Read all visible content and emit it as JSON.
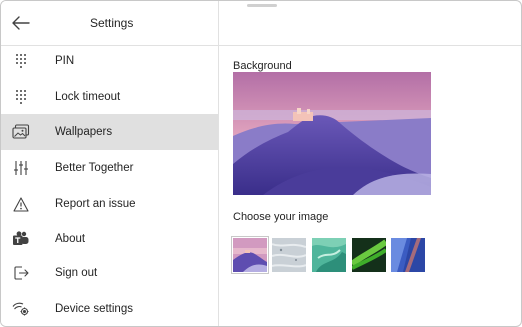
{
  "sidebar": {
    "title": "Settings",
    "items": [
      {
        "label": "PIN",
        "icon": "keypad-icon",
        "selected": false
      },
      {
        "label": "Lock timeout",
        "icon": "keypad-icon",
        "selected": false
      },
      {
        "label": "Wallpapers",
        "icon": "wallpaper-icon",
        "selected": true
      },
      {
        "label": "Better Together",
        "icon": "sliders-icon",
        "selected": false
      },
      {
        "label": "Report an issue",
        "icon": "warning-icon",
        "selected": false
      },
      {
        "label": "About",
        "icon": "teams-icon",
        "selected": false
      },
      {
        "label": "Sign out",
        "icon": "sign-out-icon",
        "selected": false
      },
      {
        "label": "Device settings",
        "icon": "device-settings-icon",
        "selected": false
      }
    ]
  },
  "main": {
    "background_label": "Background",
    "choose_label": "Choose your image",
    "thumbnails": [
      {
        "name": "purple-castle",
        "selected": true
      },
      {
        "name": "snow-texture",
        "selected": false
      },
      {
        "name": "teal-water",
        "selected": false
      },
      {
        "name": "green-aurora",
        "selected": false
      },
      {
        "name": "blue-abstract",
        "selected": false
      }
    ]
  },
  "colors": {
    "selected_bg": "#e0e0e0",
    "accent": "#6264a7"
  }
}
